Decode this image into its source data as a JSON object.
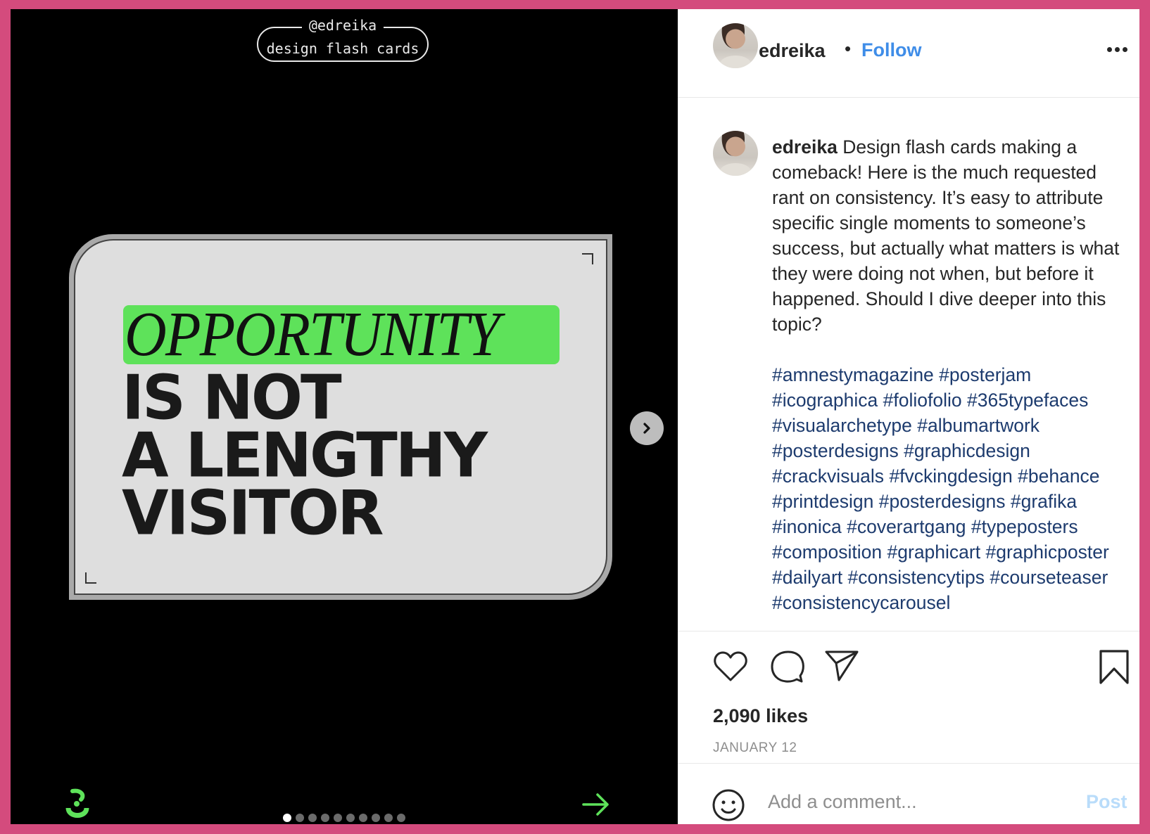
{
  "media": {
    "handle_label": "@edreika",
    "series_label": "design flash cards",
    "card": {
      "highlight_word": "OPPORTUNITY",
      "lines": [
        "IS NOT",
        "A LENGTHY",
        "VISITOR"
      ]
    },
    "highlight_color": "#5ee25a",
    "accent_color": "#5ee25a",
    "carousel": {
      "total": 10,
      "active_index": 0
    }
  },
  "header": {
    "username": "edreika",
    "separator": "•",
    "follow_label": "Follow",
    "follow_color": "#3f8de8"
  },
  "caption": {
    "username": "edreika",
    "text": "Design flash cards making a comeback! Here is the much requested rant on consistency. It’s easy to attribute specific single moments to someone’s success, but actually what matters is what they were doing not when, but before it happened. Should I dive deeper into this topic?",
    "hashtags": [
      "#amnestymagazine",
      "#posterjam",
      "#icographica",
      "#foliofolio",
      "#365typefaces",
      "#visualarchetype",
      "#albumartwork",
      "#posterdesigns",
      "#graphicdesign",
      "#crackvisuals",
      "#fvckingdesign",
      "#behance",
      "#printdesign",
      "#posterdesigns",
      "#grafika",
      "#inonica",
      "#coverartgang",
      "#typeposters",
      "#composition",
      "#graphicart",
      "#graphicposter",
      "#dailyart",
      "#consistencytips",
      "#courseteaser",
      "#consistencycarousel"
    ],
    "hashtag_color": "#1d3b6e"
  },
  "engagement": {
    "likes": "2,090 likes",
    "date": "JANUARY 12"
  },
  "comment": {
    "placeholder": "Add a comment...",
    "value": "",
    "post_label": "Post"
  },
  "icons": {
    "like": "heart-icon",
    "comment": "speech-bubble-icon",
    "share": "paper-plane-icon",
    "save": "bookmark-icon",
    "more": "more-horizontal-icon",
    "emoji": "smiley-icon",
    "next": "chevron-right-icon"
  },
  "frame_color": "#d44b7d"
}
